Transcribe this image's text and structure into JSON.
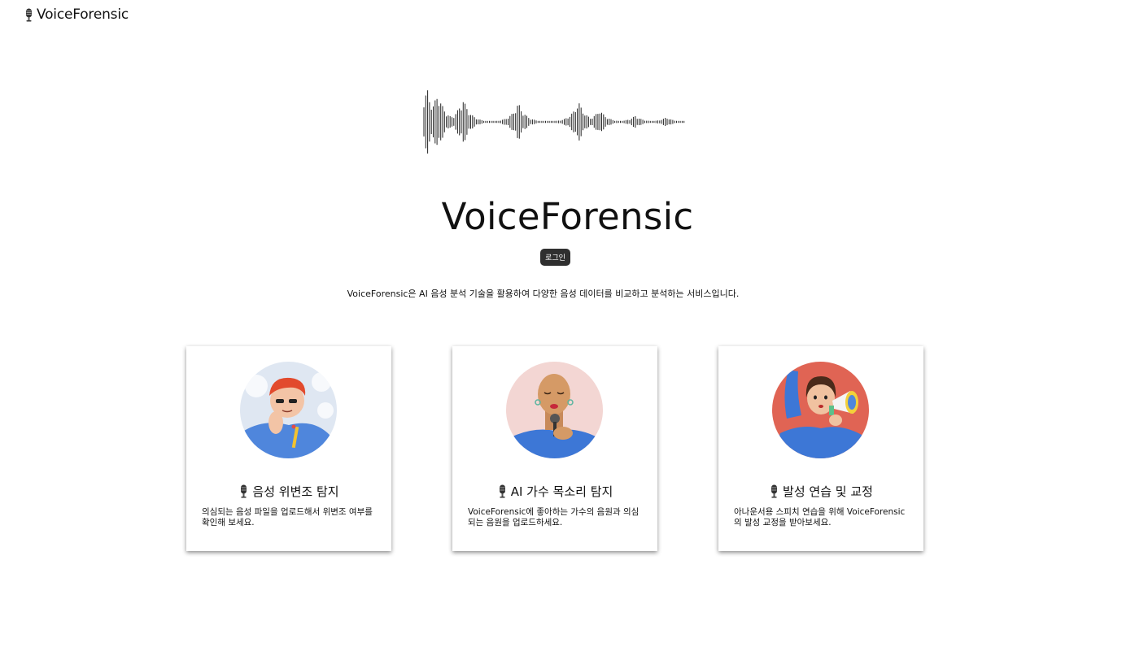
{
  "header": {
    "brand": "VoiceForensic",
    "brand_icon": "microphone-icon"
  },
  "hero": {
    "title": "VoiceForensic",
    "login_label": "로그인",
    "description": "VoiceForensic은 AI 음성 분석 기술을 활용하여 다양한 음성 데이터를 비교하고 분석하는 서비스입니다."
  },
  "cards": [
    {
      "title": "음성 위변조 탐지",
      "description": "의심되는 음성 파일을 업로드해서 위변조 여부를 확인해 보세요.",
      "icon": "microphone-icon"
    },
    {
      "title": "AI 가수 목소리 탐지",
      "description": "VoiceForensic에 좋아하는 가수의 음원과 의심되는 음원을 업로드하세요.",
      "icon": "microphone-icon"
    },
    {
      "title": "발성 연습 및 교정",
      "description": "아나운서용 스피치 연습을 위해 VoiceForensic의 발성 교정을 받아보세요.",
      "icon": "microphone-icon"
    }
  ],
  "colors": {
    "button_bg": "#2f2f2f",
    "card_shadow": "#777777",
    "avatar1_bg": "#dfe7f2",
    "avatar2_bg": "#f3d6d3",
    "avatar3_bg": "#e06454",
    "shirt_blue": "#3d77d6"
  }
}
